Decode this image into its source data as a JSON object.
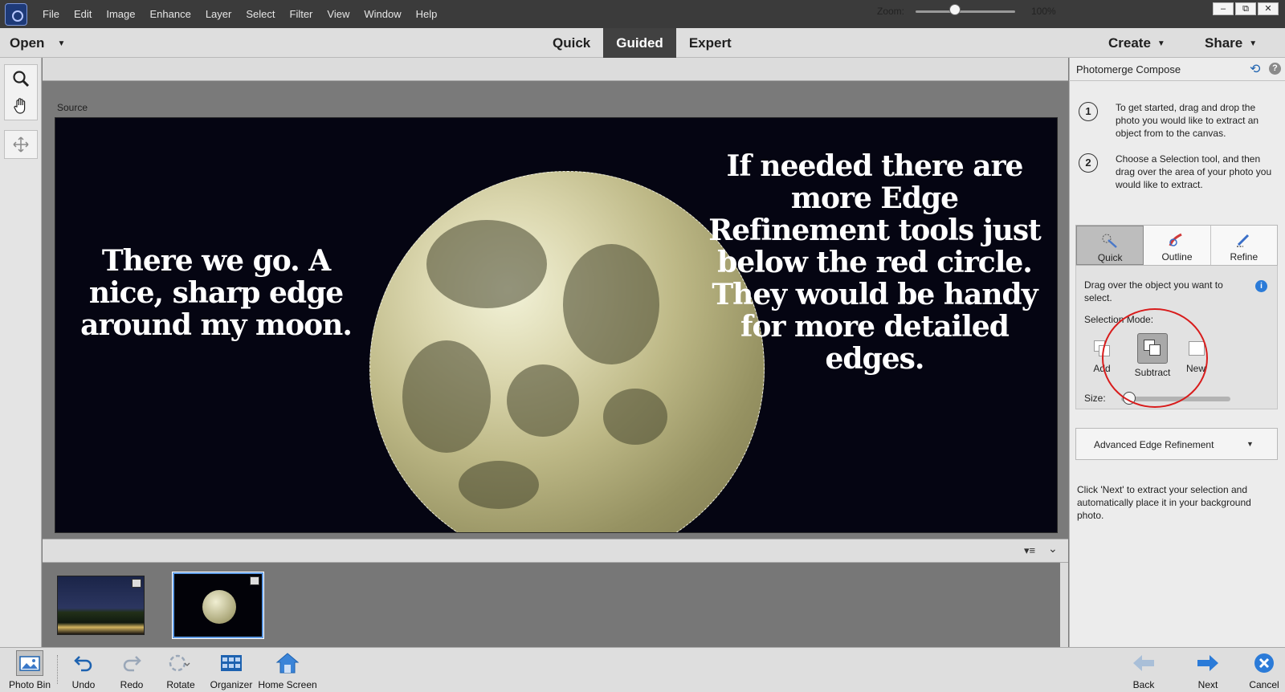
{
  "menu": [
    "File",
    "Edit",
    "Image",
    "Enhance",
    "Layer",
    "Select",
    "Filter",
    "View",
    "Window",
    "Help"
  ],
  "window_controls": [
    "–",
    "⧉",
    "✕"
  ],
  "modebar": {
    "open_label": "Open",
    "tabs": [
      "Quick",
      "Guided",
      "Expert"
    ],
    "active_tab": "Guided",
    "create_label": "Create",
    "share_label": "Share"
  },
  "zoom": {
    "label": "Zoom:",
    "value": "100%",
    "level_percent": 100
  },
  "canvas": {
    "source_label": "Source",
    "text_left": "There we go. A nice, sharp edge around my moon.",
    "text_right": "If needed there are more Edge Refinement tools just below the red circle. They would be handy for more detailed edges."
  },
  "panel": {
    "title": "Photomerge Compose",
    "steps": [
      {
        "num": "1",
        "text": "To get started, drag and drop the photo you would like to extract an object from to the canvas."
      },
      {
        "num": "2",
        "text": "Choose a Selection tool, and then drag over the area of your photo you would like to extract."
      }
    ],
    "selection_tabs": [
      "Quick",
      "Outline",
      "Refine"
    ],
    "active_selection_tab": "Quick",
    "drag_hint": "Drag over the object you want to select.",
    "selection_mode_label": "Selection Mode:",
    "modes": [
      "Add",
      "Subtract",
      "New"
    ],
    "active_mode": "Subtract",
    "size_label": "Size:",
    "advanced_label": "Advanced Edge Refinement",
    "next_hint": "Click 'Next' to extract your selection and automatically place it in your background photo."
  },
  "bottom": {
    "left": [
      "Photo Bin",
      "Undo",
      "Redo",
      "Rotate",
      "Organizer",
      "Home Screen"
    ],
    "right": [
      "Back",
      "Next",
      "Cancel"
    ]
  },
  "colors": {
    "accent_blue": "#2b7bd8",
    "highlight_red": "#d81c1c",
    "active_tab_bg": "#414141"
  }
}
